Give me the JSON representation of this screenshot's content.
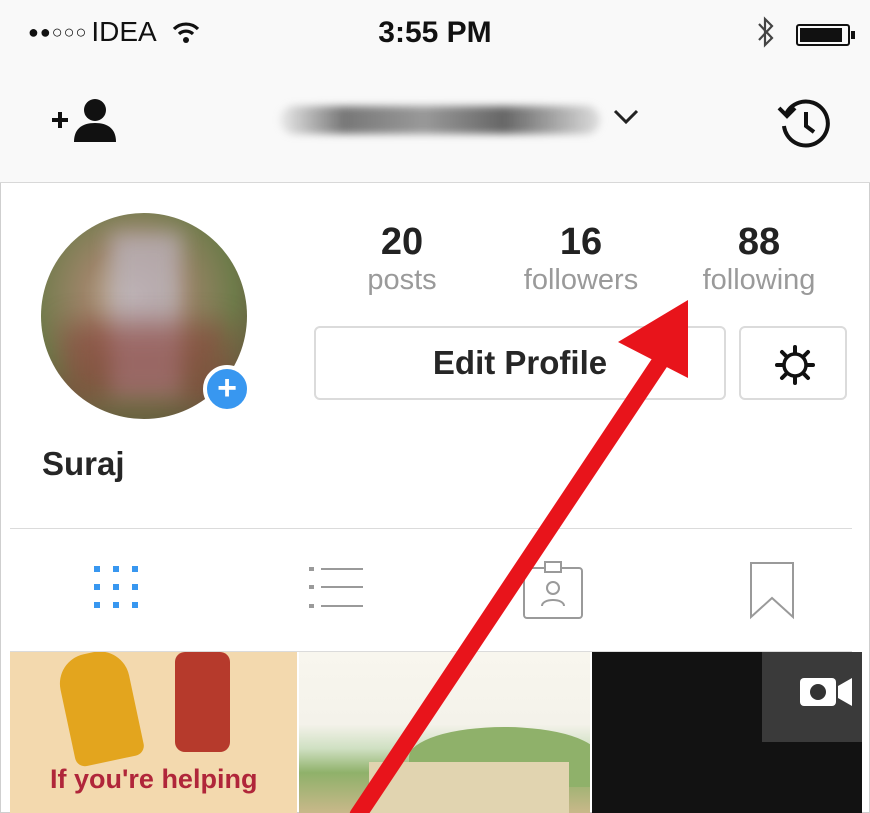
{
  "status_bar": {
    "signal_dots": "●●○○○",
    "carrier": "IDEA",
    "time": "3:55 PM",
    "icons": [
      "wifi-icon",
      "bluetooth-icon",
      "battery-icon"
    ]
  },
  "nav": {
    "icons": [
      "add-person-icon",
      "chevron-down-icon",
      "history-icon"
    ]
  },
  "profile": {
    "name": "Suraj",
    "stats": [
      {
        "value": "20",
        "label": "posts"
      },
      {
        "value": "16",
        "label": "followers"
      },
      {
        "value": "88",
        "label": "following"
      }
    ],
    "edit_button": "Edit Profile",
    "add_badge": "+"
  },
  "tabs": [
    "grid-icon",
    "list-icon",
    "tagged-icon",
    "saved-icon"
  ],
  "posts": {
    "first_caption": "If you're helping"
  },
  "colors": {
    "accent_blue": "#3897f0",
    "annotation_arrow": "#e8141b"
  }
}
